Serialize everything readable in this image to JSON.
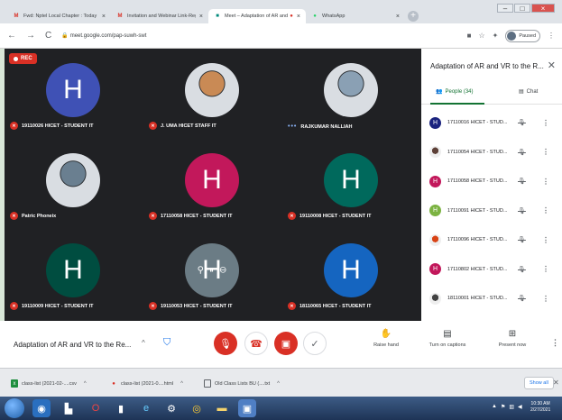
{
  "browser": {
    "tabs": [
      {
        "title": "Fwd: Nptel Local Chapter : Today",
        "icon": "gmail-icon",
        "icon_color": "#d93025",
        "active": false
      },
      {
        "title": "Invitation and Webinar Link-Reg",
        "icon": "gmail-icon",
        "icon_color": "#d93025",
        "active": false
      },
      {
        "title": "Meet – Adaptation of AR and",
        "icon": "meet-icon",
        "icon_color": "#00897b",
        "active": true
      },
      {
        "title": "WhatsApp",
        "icon": "whatsapp-icon",
        "icon_color": "#25d366",
        "active": false
      }
    ],
    "url": "meet.google.com/pap-suwh-swt",
    "profile_status": "Paused"
  },
  "meeting": {
    "recording_label": "REC",
    "tiles": [
      {
        "name": "19110026 HICET - STUDENT IT",
        "letter": "H",
        "color": "#3f51b5",
        "photo": false,
        "muted": true
      },
      {
        "name": "J. UMA HICET STAFF IT",
        "letter": "",
        "color": "#c98a55",
        "photo": true,
        "muted": true
      },
      {
        "name": "RAJKUMAR NALLIAH",
        "letter": "",
        "color": "#8aa0b4",
        "photo": true,
        "muted": false
      },
      {
        "name": "Patric Phoneix",
        "letter": "",
        "color": "#6a7f90",
        "photo": true,
        "muted": true
      },
      {
        "name": "17110058 HICET - STUDENT IT",
        "letter": "H",
        "color": "#c2185b",
        "photo": false,
        "muted": true
      },
      {
        "name": "19110008 HICET - STUDENT IT",
        "letter": "H",
        "color": "#00695c",
        "photo": false,
        "muted": true
      },
      {
        "name": "19110009 HICET - STUDENT IT",
        "letter": "H",
        "color": "#004d40",
        "photo": false,
        "muted": true
      },
      {
        "name": "19110053 HICET - STUDENT IT",
        "letter": "H",
        "color": "#6b7c85",
        "photo": false,
        "muted": true
      },
      {
        "name": "18110065 HICET - STUDENT IT",
        "letter": "H",
        "color": "#1565c0",
        "photo": false,
        "muted": true
      }
    ]
  },
  "panel": {
    "title": "Adaptation of AR and VR to the R...",
    "people_tab": "People (34)",
    "chat_tab": "Chat",
    "people": [
      {
        "name": "17110016 HICET - STUD...",
        "letter": "H",
        "color": "#1a237e",
        "photo": false
      },
      {
        "name": "17110054 HICET - STUD...",
        "letter": "",
        "color": "#5d4037",
        "photo": true
      },
      {
        "name": "17110058 HICET - STUD...",
        "letter": "H",
        "color": "#c2185b",
        "photo": false
      },
      {
        "name": "17110091 HICET - STUD...",
        "letter": "H",
        "color": "#7cb342",
        "photo": false
      },
      {
        "name": "17110096 HICET - STUD...",
        "letter": "",
        "color": "#d84315",
        "photo": true
      },
      {
        "name": "17110802 HICET - STUD...",
        "letter": "H",
        "color": "#c2185b",
        "photo": false
      },
      {
        "name": "18110001 HICET - STUD...",
        "letter": "",
        "color": "#424242",
        "photo": true
      }
    ]
  },
  "bottombar": {
    "meeting_title": "Adaptation of AR and VR to the Re...",
    "raise_hand": "Raise hand",
    "captions": "Turn on captions",
    "present": "Present now"
  },
  "downloads": {
    "items": [
      {
        "name": "class-list (2021-02-....csv",
        "icon_color": "#1e8e3e"
      },
      {
        "name": "class-list (2021-0....html",
        "icon_color": "#d93025"
      },
      {
        "name": "Old Class Lists BU (....txt",
        "icon_color": "#5f6368"
      }
    ],
    "show_all": "Show all"
  },
  "taskbar": {
    "time": "10:30 AM",
    "date": "2/27/2021"
  }
}
